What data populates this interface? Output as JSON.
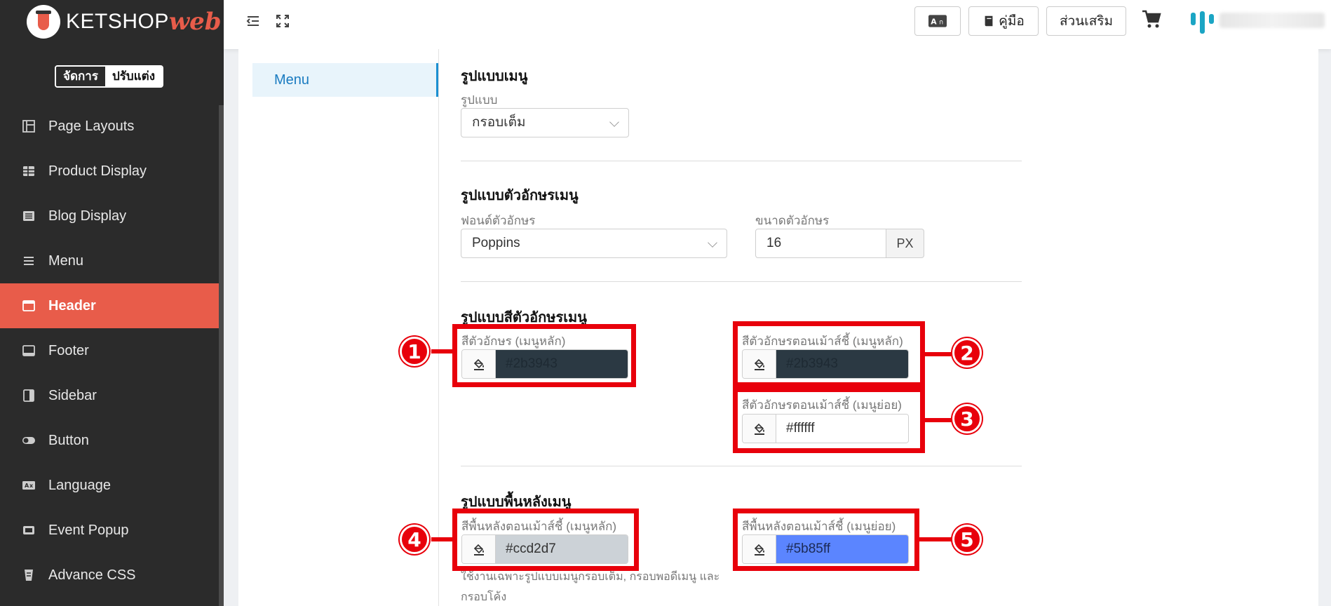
{
  "brand": {
    "name": "KETSHOP",
    "suffix": "web"
  },
  "mode_toggle": {
    "manage": "จัดการ",
    "customize": "ปรับแต่ง"
  },
  "sidebar": {
    "items": [
      {
        "label": "Page Layouts",
        "icon": "layout-icon"
      },
      {
        "label": "Product Display",
        "icon": "grid-icon"
      },
      {
        "label": "Blog Display",
        "icon": "list-icon"
      },
      {
        "label": "Menu",
        "icon": "menu-icon"
      },
      {
        "label": "Header",
        "icon": "header-icon",
        "active": true
      },
      {
        "label": "Footer",
        "icon": "footer-icon"
      },
      {
        "label": "Sidebar",
        "icon": "sidebar-icon"
      },
      {
        "label": "Button",
        "icon": "toggle-icon"
      },
      {
        "label": "Language",
        "icon": "language-icon"
      },
      {
        "label": "Event Popup",
        "icon": "popup-icon"
      },
      {
        "label": "Advance CSS",
        "icon": "css-icon"
      }
    ]
  },
  "topbar": {
    "manual_label": "คู่มือ",
    "addons_label": "ส่วนเสริม"
  },
  "subnav": {
    "active": "Menu"
  },
  "menu_style": {
    "title": "รูปแบบเมนู",
    "style_label": "รูปแบบ",
    "style_value": "กรอบเต็ม"
  },
  "font_style": {
    "title": "รูปแบบตัวอักษรเมนู",
    "font_label": "ฟอนต์ตัวอักษร",
    "font_value": "Poppins",
    "size_label": "ขนาดตัวอักษร",
    "size_value": "16",
    "size_unit": "PX"
  },
  "font_color": {
    "title": "รูปแบบสีตัวอักษรเมนู",
    "main_label": "สีตัวอักษร (เมนูหลัก)",
    "main_value": "#2b3943",
    "hover_main_label": "สีตัวอักษรตอนเม้าส์ชี้ (เมนูหลัก)",
    "hover_main_value": "#2b3943",
    "hover_sub_label": "สีตัวอักษรตอนเม้าส์ชี้ (เมนูย่อย)",
    "hover_sub_value": "#ffffff"
  },
  "bg_color": {
    "title": "รูปแบบพื้นหลังเมนู",
    "hover_main_label": "สีพื้นหลังตอนเม้าส์ชี้ (เมนูหลัก)",
    "hover_main_value": "#ccd2d7",
    "hover_sub_label": "สีพื้นหลังตอนเม้าส์ชี้ (เมนูย่อย)",
    "hover_sub_value": "#5b85ff",
    "note": "ใช้งานเฉพาะรูปแบบเมนูกรอบเต็ม, กรอบพอดีเมนู และกรอบโค้ง"
  },
  "annotations": [
    "1",
    "2",
    "3",
    "4",
    "5"
  ],
  "colors": {
    "sidebar_bg": "#2b2b2b",
    "accent": "#e85c4a",
    "highlight": "#e8000b",
    "link": "#1a7bc0"
  }
}
